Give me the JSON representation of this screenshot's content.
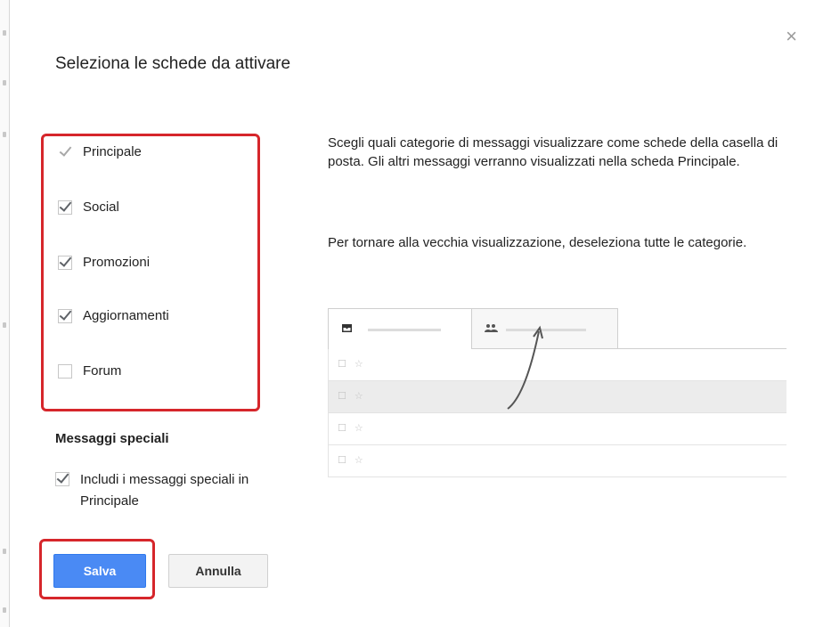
{
  "dialog": {
    "title": "Seleziona le schede da attivare",
    "close_label": "×"
  },
  "categories": [
    {
      "label": "Principale",
      "checked": true,
      "disabled": true
    },
    {
      "label": "Social",
      "checked": true,
      "disabled": false
    },
    {
      "label": "Promozioni",
      "checked": true,
      "disabled": false
    },
    {
      "label": "Aggiornamenti",
      "checked": true,
      "disabled": false
    },
    {
      "label": "Forum",
      "checked": false,
      "disabled": false
    }
  ],
  "special": {
    "heading": "Messaggi speciali",
    "option_label": "Includi i messaggi speciali in Principale",
    "checked": true
  },
  "buttons": {
    "save_label": "Salva",
    "cancel_label": "Annulla"
  },
  "description": {
    "paragraph1": "Scegli quali categorie di messaggi visualizzare come schede della casella di posta. Gli altri messaggi verranno visualizzati nella scheda Principale.",
    "paragraph2": "Per tornare alla vecchia visualizzazione, deseleziona tutte le categorie."
  },
  "preview": {
    "tab1_icon": "inbox-icon",
    "tab2_icon": "social-icon",
    "row_icons": [
      "checkbox-icon",
      "star-icon"
    ],
    "highlighted_row": 1,
    "row_count": 4
  },
  "colors": {
    "highlight_border": "#d6262b",
    "primary_button": "#4a8af4"
  }
}
